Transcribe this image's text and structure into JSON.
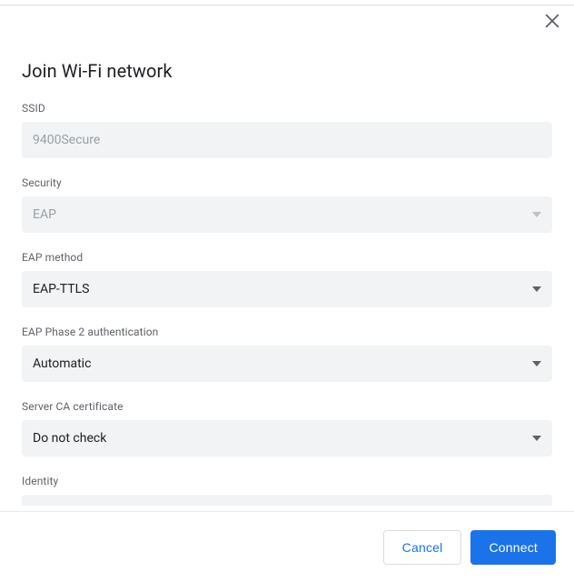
{
  "dialog": {
    "title": "Join Wi-Fi network"
  },
  "fields": {
    "ssid": {
      "label": "SSID",
      "value": "9400Secure"
    },
    "security": {
      "label": "Security",
      "value": "EAP"
    },
    "eap_method": {
      "label": "EAP method",
      "value": "EAP-TTLS"
    },
    "eap_phase2": {
      "label": "EAP Phase 2 authentication",
      "value": "Automatic"
    },
    "server_ca": {
      "label": "Server CA certificate",
      "value": "Do not check"
    },
    "identity": {
      "label": "Identity",
      "value": ""
    }
  },
  "footer": {
    "cancel": "Cancel",
    "connect": "Connect"
  }
}
